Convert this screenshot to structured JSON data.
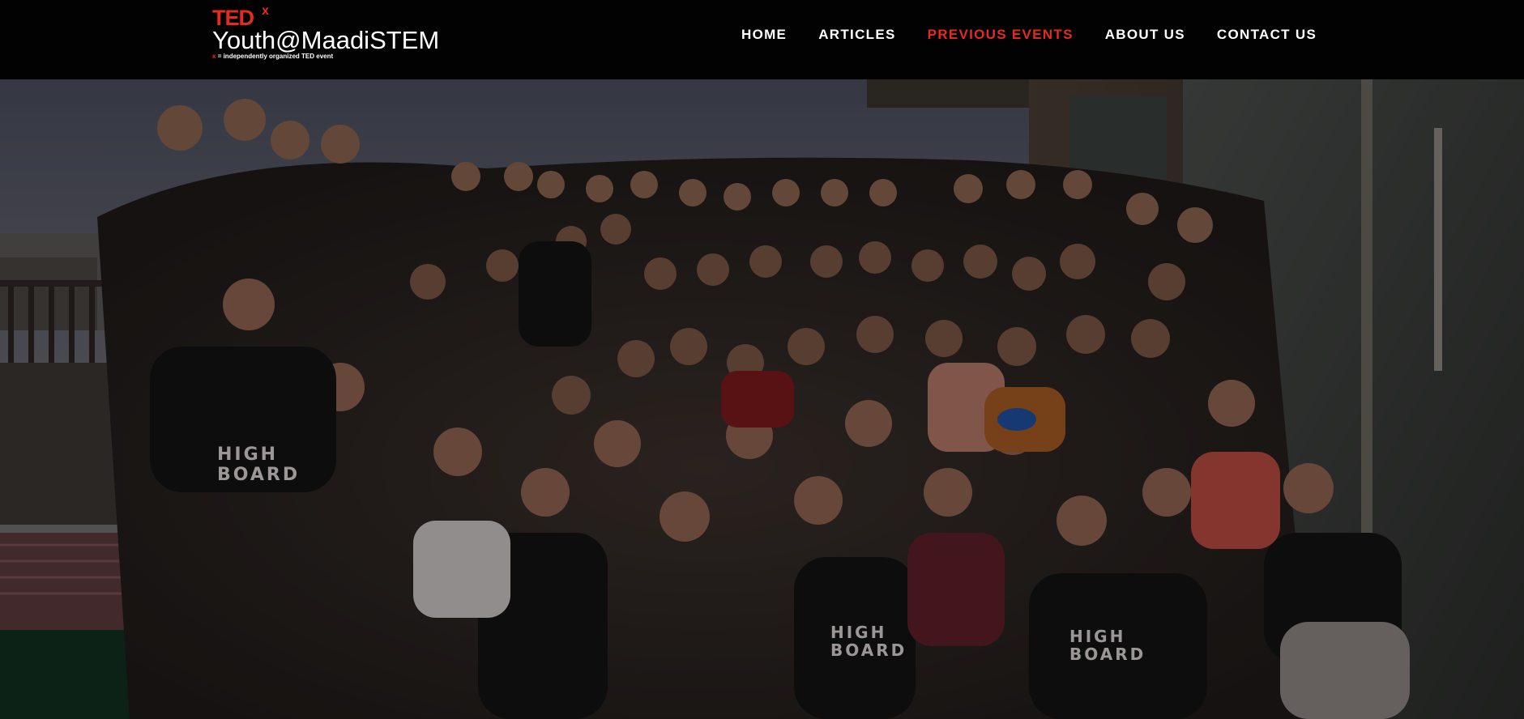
{
  "header": {
    "logo": {
      "brand": "TED",
      "superscript": "x",
      "event_name": "Youth@MaadiSTEM",
      "tagline_mark": "x",
      "tagline": "= independently organized TED event"
    },
    "menu": [
      {
        "label": "HOME",
        "active": false
      },
      {
        "label": "ARTICLES",
        "active": false
      },
      {
        "label": "PREVIOUS EVENTS",
        "active": true
      },
      {
        "label": "ABOUT US",
        "active": false
      },
      {
        "label": "CONTACT US",
        "active": false
      }
    ]
  },
  "hero": {
    "image_subject": "group-photo",
    "shirt_text": "HIGH BOARD"
  },
  "colors": {
    "nav_bg": "#020202",
    "accent": "#e62b1e",
    "nav_text": "#ffffff"
  }
}
